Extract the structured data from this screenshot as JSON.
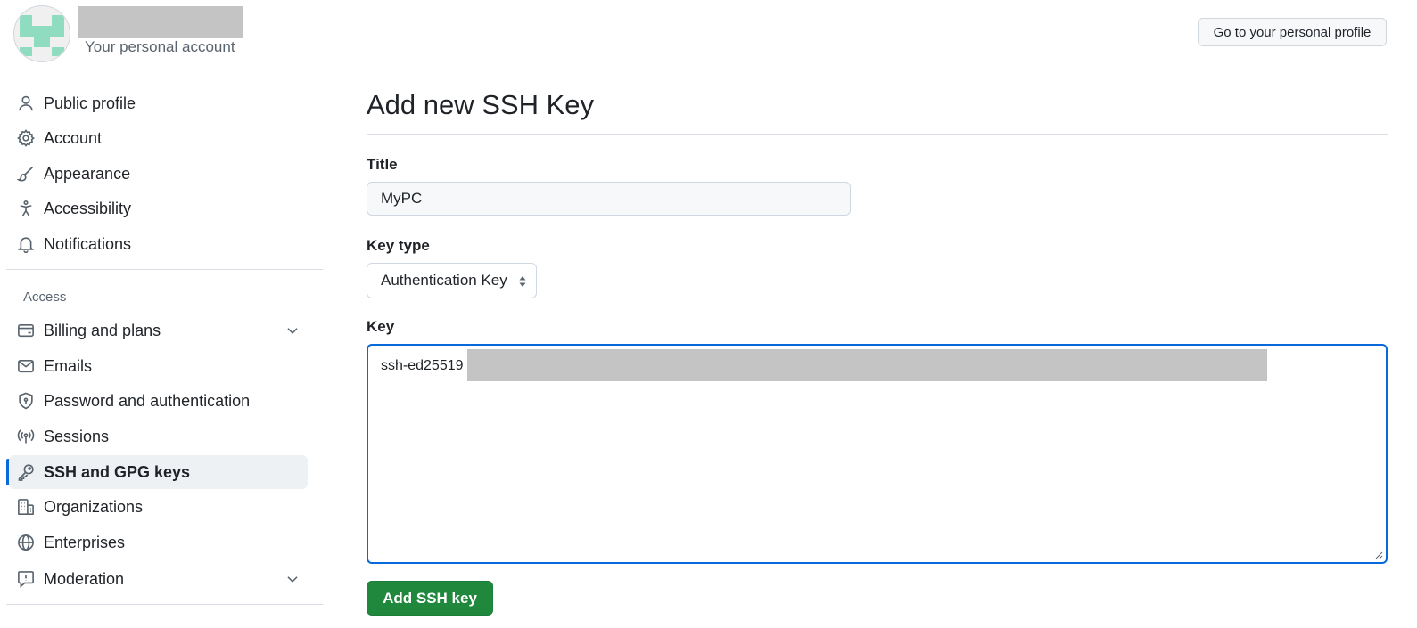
{
  "header": {
    "account_subtitle": "Your personal account",
    "profile_button": "Go to your personal profile"
  },
  "sidebar": {
    "items_top": [
      {
        "label": "Public profile",
        "icon": "person-icon"
      },
      {
        "label": "Account",
        "icon": "gear-icon"
      },
      {
        "label": "Appearance",
        "icon": "paintbrush-icon"
      },
      {
        "label": "Accessibility",
        "icon": "accessibility-icon"
      },
      {
        "label": "Notifications",
        "icon": "bell-icon"
      }
    ],
    "section_access": "Access",
    "items_access": [
      {
        "label": "Billing and plans",
        "icon": "credit-card-icon",
        "expandable": true
      },
      {
        "label": "Emails",
        "icon": "mail-icon"
      },
      {
        "label": "Password and authentication",
        "icon": "shield-lock-icon"
      },
      {
        "label": "Sessions",
        "icon": "broadcast-icon"
      },
      {
        "label": "SSH and GPG keys",
        "icon": "key-icon",
        "active": true
      },
      {
        "label": "Organizations",
        "icon": "organization-icon"
      },
      {
        "label": "Enterprises",
        "icon": "globe-icon"
      },
      {
        "label": "Moderation",
        "icon": "report-icon",
        "expandable": true
      }
    ]
  },
  "main": {
    "title": "Add new SSH Key",
    "title_label": "Title",
    "title_value": "MyPC",
    "key_type_label": "Key type",
    "key_type_value": "Authentication Key",
    "key_label": "Key",
    "key_value": "ssh-ed25519",
    "submit_label": "Add SSH key"
  },
  "colors": {
    "accent": "#0969da",
    "primary_button": "#1f883d",
    "active_nav_bg": "#eef1f4"
  }
}
